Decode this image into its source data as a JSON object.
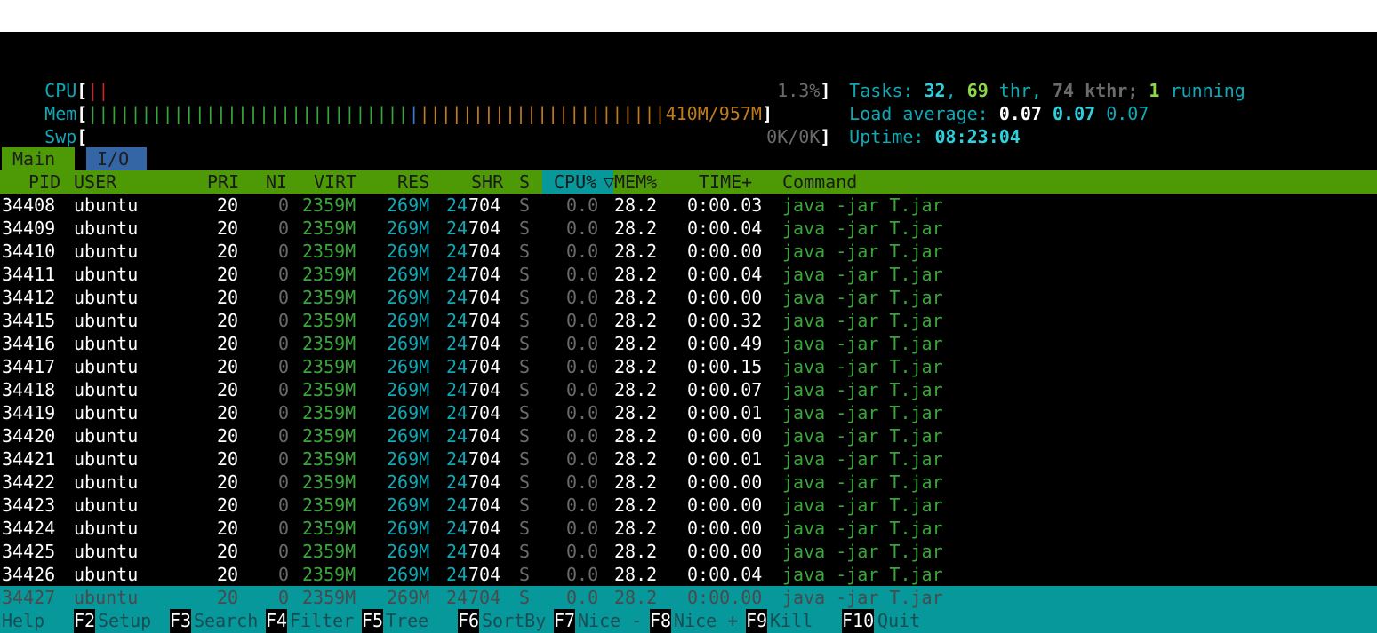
{
  "meters": {
    "cpu": {
      "label": "CPU",
      "bar": "||",
      "value": "1.3%"
    },
    "mem": {
      "label": "Mem",
      "bar_green": "||||||||||||||||||||||||||||||",
      "bar_blue": "|",
      "bar_orange": "|||||||||||||||||||||||",
      "value": "410M/957M"
    },
    "swp": {
      "label": "Swp",
      "value": "0K/0K"
    },
    "tasks_label": "Tasks:",
    "tasks": "32",
    "thr": "69",
    "thr_label": "thr,",
    "kthr": "74",
    "kthr_label": "kthr;",
    "running": "1",
    "running_label": "running",
    "load_label": "Load average:",
    "load1": "0.07",
    "load5": "0.07",
    "load15": "0.07",
    "uptime_label": "Uptime:",
    "uptime": "08:23:04"
  },
  "tabs": {
    "main": "Main",
    "io": "I/O"
  },
  "columns": {
    "pid": "PID",
    "user": "USER",
    "pri": "PRI",
    "ni": "NI",
    "virt": "VIRT",
    "res": "RES",
    "shr": "SHR",
    "s": "S",
    "cpu": "CPU%",
    "mem": "MEM%",
    "time": "TIME+",
    "command": "Command",
    "sort_indicator": "▽"
  },
  "processes": [
    {
      "pid": "34408",
      "user": "ubuntu",
      "pri": "20",
      "ni": "0",
      "virt": "2359M",
      "res": "269M",
      "shr_hi": "24",
      "shr_lo": "704",
      "s": "S",
      "cpu": "0.0",
      "mem": "28.2",
      "time": "0:00.03",
      "command": "java -jar T.jar"
    },
    {
      "pid": "34409",
      "user": "ubuntu",
      "pri": "20",
      "ni": "0",
      "virt": "2359M",
      "res": "269M",
      "shr_hi": "24",
      "shr_lo": "704",
      "s": "S",
      "cpu": "0.0",
      "mem": "28.2",
      "time": "0:00.04",
      "command": "java -jar T.jar"
    },
    {
      "pid": "34410",
      "user": "ubuntu",
      "pri": "20",
      "ni": "0",
      "virt": "2359M",
      "res": "269M",
      "shr_hi": "24",
      "shr_lo": "704",
      "s": "S",
      "cpu": "0.0",
      "mem": "28.2",
      "time": "0:00.00",
      "command": "java -jar T.jar"
    },
    {
      "pid": "34411",
      "user": "ubuntu",
      "pri": "20",
      "ni": "0",
      "virt": "2359M",
      "res": "269M",
      "shr_hi": "24",
      "shr_lo": "704",
      "s": "S",
      "cpu": "0.0",
      "mem": "28.2",
      "time": "0:00.04",
      "command": "java -jar T.jar"
    },
    {
      "pid": "34412",
      "user": "ubuntu",
      "pri": "20",
      "ni": "0",
      "virt": "2359M",
      "res": "269M",
      "shr_hi": "24",
      "shr_lo": "704",
      "s": "S",
      "cpu": "0.0",
      "mem": "28.2",
      "time": "0:00.00",
      "command": "java -jar T.jar"
    },
    {
      "pid": "34415",
      "user": "ubuntu",
      "pri": "20",
      "ni": "0",
      "virt": "2359M",
      "res": "269M",
      "shr_hi": "24",
      "shr_lo": "704",
      "s": "S",
      "cpu": "0.0",
      "mem": "28.2",
      "time": "0:00.32",
      "command": "java -jar T.jar"
    },
    {
      "pid": "34416",
      "user": "ubuntu",
      "pri": "20",
      "ni": "0",
      "virt": "2359M",
      "res": "269M",
      "shr_hi": "24",
      "shr_lo": "704",
      "s": "S",
      "cpu": "0.0",
      "mem": "28.2",
      "time": "0:00.49",
      "command": "java -jar T.jar"
    },
    {
      "pid": "34417",
      "user": "ubuntu",
      "pri": "20",
      "ni": "0",
      "virt": "2359M",
      "res": "269M",
      "shr_hi": "24",
      "shr_lo": "704",
      "s": "S",
      "cpu": "0.0",
      "mem": "28.2",
      "time": "0:00.15",
      "command": "java -jar T.jar"
    },
    {
      "pid": "34418",
      "user": "ubuntu",
      "pri": "20",
      "ni": "0",
      "virt": "2359M",
      "res": "269M",
      "shr_hi": "24",
      "shr_lo": "704",
      "s": "S",
      "cpu": "0.0",
      "mem": "28.2",
      "time": "0:00.07",
      "command": "java -jar T.jar"
    },
    {
      "pid": "34419",
      "user": "ubuntu",
      "pri": "20",
      "ni": "0",
      "virt": "2359M",
      "res": "269M",
      "shr_hi": "24",
      "shr_lo": "704",
      "s": "S",
      "cpu": "0.0",
      "mem": "28.2",
      "time": "0:00.01",
      "command": "java -jar T.jar"
    },
    {
      "pid": "34420",
      "user": "ubuntu",
      "pri": "20",
      "ni": "0",
      "virt": "2359M",
      "res": "269M",
      "shr_hi": "24",
      "shr_lo": "704",
      "s": "S",
      "cpu": "0.0",
      "mem": "28.2",
      "time": "0:00.00",
      "command": "java -jar T.jar"
    },
    {
      "pid": "34421",
      "user": "ubuntu",
      "pri": "20",
      "ni": "0",
      "virt": "2359M",
      "res": "269M",
      "shr_hi": "24",
      "shr_lo": "704",
      "s": "S",
      "cpu": "0.0",
      "mem": "28.2",
      "time": "0:00.01",
      "command": "java -jar T.jar"
    },
    {
      "pid": "34422",
      "user": "ubuntu",
      "pri": "20",
      "ni": "0",
      "virt": "2359M",
      "res": "269M",
      "shr_hi": "24",
      "shr_lo": "704",
      "s": "S",
      "cpu": "0.0",
      "mem": "28.2",
      "time": "0:00.00",
      "command": "java -jar T.jar"
    },
    {
      "pid": "34423",
      "user": "ubuntu",
      "pri": "20",
      "ni": "0",
      "virt": "2359M",
      "res": "269M",
      "shr_hi": "24",
      "shr_lo": "704",
      "s": "S",
      "cpu": "0.0",
      "mem": "28.2",
      "time": "0:00.00",
      "command": "java -jar T.jar"
    },
    {
      "pid": "34424",
      "user": "ubuntu",
      "pri": "20",
      "ni": "0",
      "virt": "2359M",
      "res": "269M",
      "shr_hi": "24",
      "shr_lo": "704",
      "s": "S",
      "cpu": "0.0",
      "mem": "28.2",
      "time": "0:00.00",
      "command": "java -jar T.jar"
    },
    {
      "pid": "34425",
      "user": "ubuntu",
      "pri": "20",
      "ni": "0",
      "virt": "2359M",
      "res": "269M",
      "shr_hi": "24",
      "shr_lo": "704",
      "s": "S",
      "cpu": "0.0",
      "mem": "28.2",
      "time": "0:00.00",
      "command": "java -jar T.jar"
    },
    {
      "pid": "34426",
      "user": "ubuntu",
      "pri": "20",
      "ni": "0",
      "virt": "2359M",
      "res": "269M",
      "shr_hi": "24",
      "shr_lo": "704",
      "s": "S",
      "cpu": "0.0",
      "mem": "28.2",
      "time": "0:00.04",
      "command": "java -jar T.jar"
    },
    {
      "pid": "34427",
      "user": "ubuntu",
      "pri": "20",
      "ni": "0",
      "virt": "2359M",
      "res": "269M",
      "shr_hi": "24",
      "shr_lo": "704",
      "s": "S",
      "cpu": "0.0",
      "mem": "28.2",
      "time": "0:00.00",
      "command": "java -jar T.jar",
      "selected": true
    }
  ],
  "footer": [
    {
      "key": "",
      "label": "Help"
    },
    {
      "key": "F2",
      "label": "Setup"
    },
    {
      "key": "F3",
      "label": "Search"
    },
    {
      "key": "F4",
      "label": "Filter"
    },
    {
      "key": "F5",
      "label": "Tree"
    },
    {
      "key": "F6",
      "label": "SortBy"
    },
    {
      "key": "F7",
      "label": "Nice -"
    },
    {
      "key": "F8",
      "label": "Nice +"
    },
    {
      "key": "F9",
      "label": "Kill"
    },
    {
      "key": "F10",
      "label": "Quit"
    }
  ],
  "colors": {
    "terminal_bg": "#000000",
    "header_bg": "#4e9a06",
    "selected_bg": "#06989a",
    "io_tab_bg": "#3465a4"
  }
}
